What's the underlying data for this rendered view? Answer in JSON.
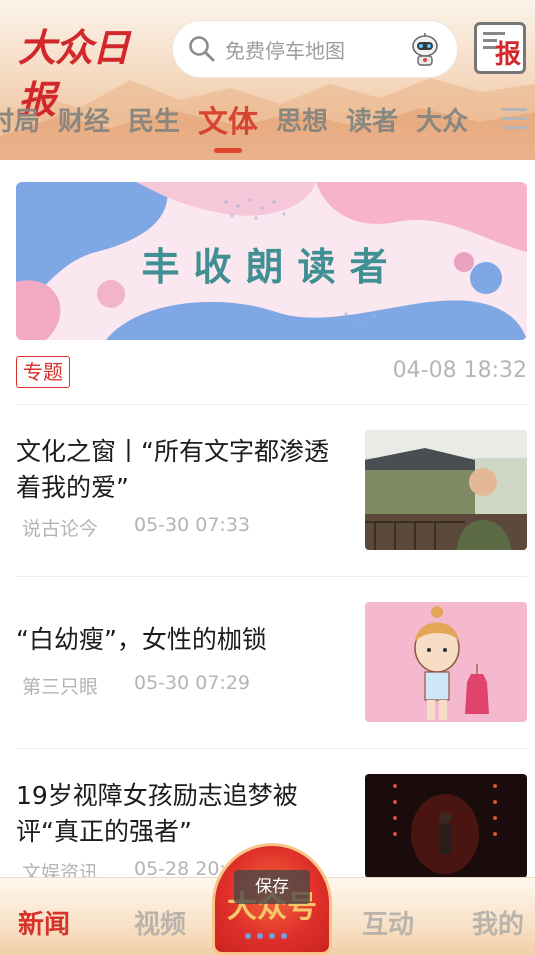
{
  "header": {
    "logo_text": "大众日报",
    "search_placeholder": "免费停车地图",
    "paper_button_label": "报"
  },
  "tabs": [
    {
      "label": "时局",
      "active": false
    },
    {
      "label": "财经",
      "active": false
    },
    {
      "label": "民生",
      "active": false
    },
    {
      "label": "文体",
      "active": true
    },
    {
      "label": "思想",
      "active": false
    },
    {
      "label": "读者",
      "active": false
    },
    {
      "label": "大众",
      "active": false
    }
  ],
  "banner": {
    "title": "丰收朗读者",
    "tag": "专题",
    "time": "04-08 18:32"
  },
  "news": [
    {
      "title": "文化之窗丨“所有文字都渗透着我的爱”",
      "source": "说古论今",
      "time": "05-30 07:33",
      "thumb": "man-in-garden-photo"
    },
    {
      "title": "“白幼瘦”，女性的枷锁",
      "source": "第三只眼",
      "time": "05-30 07:29",
      "thumb": "girl-cartoon-illustration"
    },
    {
      "title": "19岁视障女孩励志追梦被评“真正的强者”",
      "source": "文娱资讯",
      "time": "05-28 20:",
      "thumb": "stage-performance-photo"
    }
  ],
  "bottom_nav": {
    "items": [
      {
        "label": "新闻",
        "active": true
      },
      {
        "label": "视频",
        "active": false
      },
      {
        "label": "互动",
        "active": false
      },
      {
        "label": "我的",
        "active": false
      }
    ],
    "center_label": "大众号",
    "toast": "保存"
  },
  "colors": {
    "accent": "#d3282b",
    "tab_active": "#d6452f",
    "muted_text": "#b4b4b4"
  }
}
